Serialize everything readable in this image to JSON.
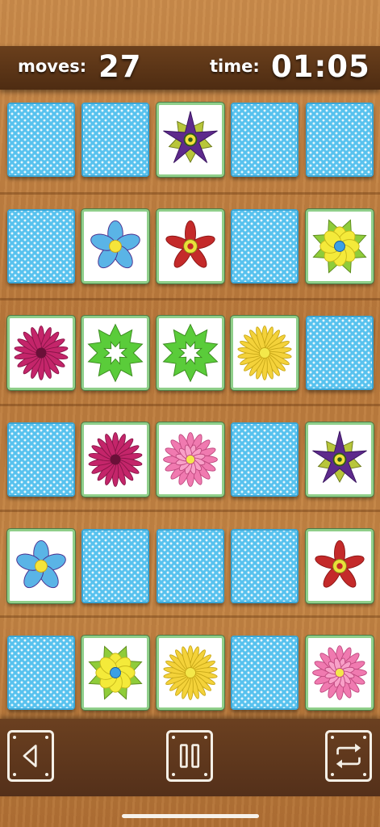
{
  "hud": {
    "moves_label": "moves:",
    "moves_value": "27",
    "time_label": "time:",
    "time_value": "01:05"
  },
  "board": {
    "rows": 6,
    "cols": 5,
    "cards": [
      [
        "back",
        "back",
        "star-flower-purple",
        "back",
        "back"
      ],
      [
        "back",
        "blue-flower",
        "red-flower",
        "back",
        "yellow-green-flower"
      ],
      [
        "magenta-daisy",
        "green-flower",
        "green-flower",
        "yellow-daisy",
        "back"
      ],
      [
        "back",
        "magenta-daisy",
        "pink-daisy",
        "back",
        "star-flower-purple"
      ],
      [
        "blue-flower",
        "back",
        "back",
        "back",
        "red-flower"
      ],
      [
        "back",
        "yellow-green-flower",
        "yellow-daisy",
        "back",
        "pink-daisy"
      ]
    ]
  },
  "controls": {
    "back_icon": "back-arrow-icon",
    "pause_icon": "pause-icon",
    "restart_icon": "restart-icon"
  },
  "colors": {
    "card_back": "#58c2ee",
    "card_border": "#8fcf8a",
    "hud_bg": "#5a3317",
    "text": "#ffffff"
  }
}
